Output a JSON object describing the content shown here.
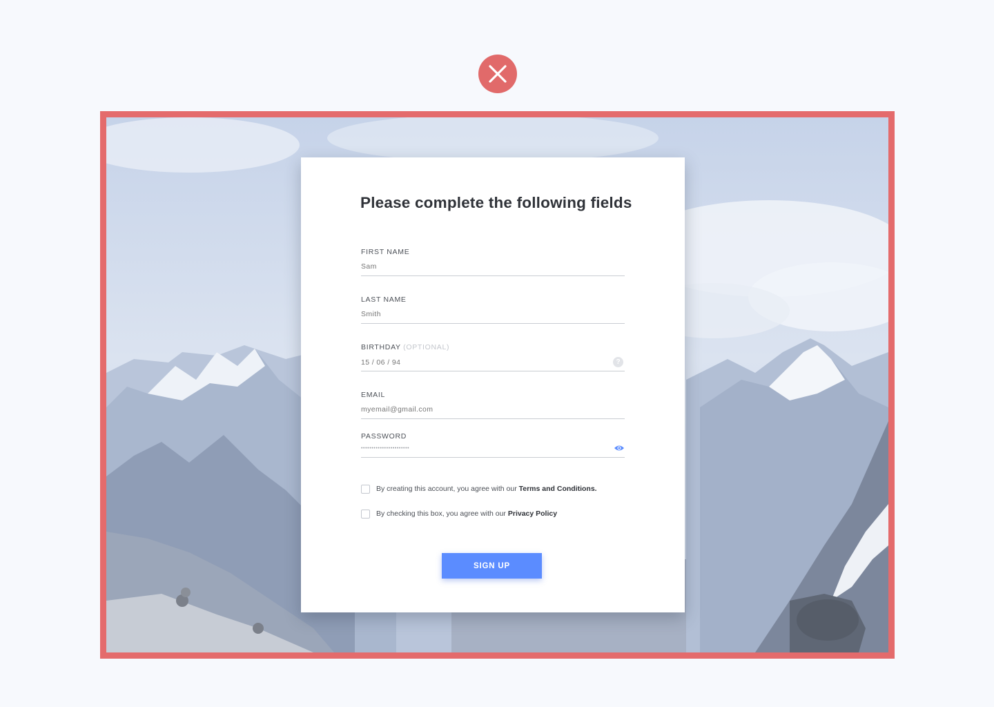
{
  "status_icon": "close-icon",
  "colors": {
    "error": "#e46b6c",
    "accent": "#5b8cff"
  },
  "form": {
    "title": "Please complete the following fields",
    "fields": {
      "first_name": {
        "label": "FIRST NAME",
        "placeholder": "Sam"
      },
      "last_name": {
        "label": "LAST NAME",
        "placeholder": "Smith"
      },
      "birthday": {
        "label": "BIRTHDAY",
        "optional": "(OPTIONAL)",
        "placeholder": "15 / 06 / 94",
        "icon": "help-icon"
      },
      "email": {
        "label": "EMAIL",
        "placeholder": "myemail@gmail.com"
      },
      "password": {
        "label": "PASSWORD",
        "value": "•••••••••••••••••••••••",
        "icon": "eye-icon"
      }
    },
    "terms": {
      "text": "By creating this account, you agree with our ",
      "link": "Terms and Conditions."
    },
    "privacy": {
      "text": "By checking this box, you agree with our ",
      "link": "Privacy Policy"
    },
    "submit_label": "SIGN UP"
  }
}
